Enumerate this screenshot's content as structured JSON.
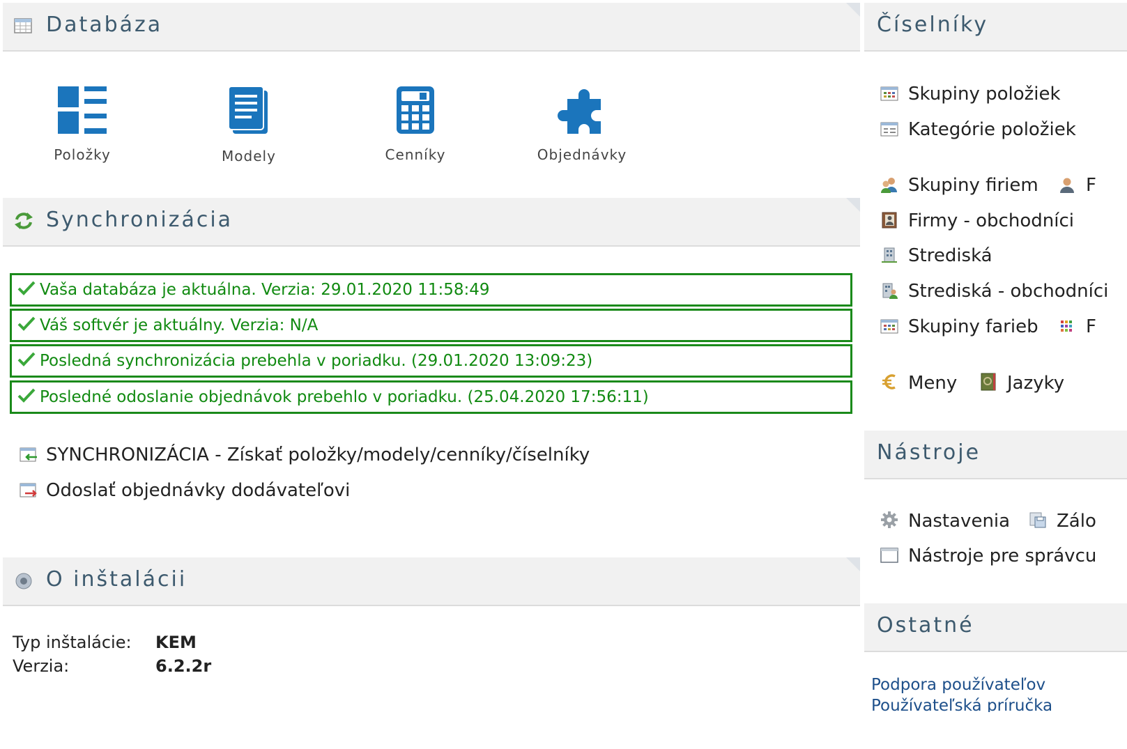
{
  "databaza": {
    "title": "Databáza",
    "tiles": [
      {
        "label": "Položky",
        "icon": "list-grid-icon"
      },
      {
        "label": "Modely",
        "icon": "document-icon"
      },
      {
        "label": "Cenníky",
        "icon": "calculator-icon"
      },
      {
        "label": "Objednávky",
        "icon": "puzzle-icon"
      }
    ]
  },
  "synchronizacia": {
    "title": "Synchronizácia",
    "status": [
      "Vaša databáza je aktuálna. Verzia: 29.01.2020 11:58:49",
      "Váš softvér je aktuálny. Verzia: N/A",
      "Posledná synchronizácia prebehla v poriadku. (29.01.2020 13:09:23)",
      "Posledné odoslanie objednávok prebehlo v poriadku. (25.04.2020 17:56:11)"
    ],
    "actions": [
      "SYNCHRONIZÁCIA - Získať položky/modely/cenníky/číselníky",
      "Odoslať objednávky dodávateľovi"
    ]
  },
  "instalacia": {
    "title": "O inštalácii",
    "rows": [
      {
        "label": "Typ inštalácie:",
        "value": "KEM"
      },
      {
        "label": "Verzia:",
        "value": "6.2.2r"
      }
    ]
  },
  "ciselniky": {
    "title": "Číselníky",
    "items": {
      "skupiny_poloziek": "Skupiny položiek",
      "kategorie_poloziek": "Kategórie položiek",
      "skupiny_firiem": "Skupiny firiem",
      "firmy_partial": "F",
      "firmy_obchodnici": "Firmy - obchodníci",
      "strediska": "Strediská",
      "strediska_obchodnici": "Strediská - obchodníci",
      "skupiny_farieb": "Skupiny farieb",
      "farby_partial": "F",
      "meny": "Meny",
      "jazyky": "Jazyky"
    }
  },
  "nastroje": {
    "title": "Nástroje",
    "items": {
      "nastavenia": "Nastavenia",
      "zaloha_partial": "Zálo",
      "nastroje_spravcu": "Nástroje pre správcu"
    }
  },
  "ostatne": {
    "title": "Ostatné",
    "links": [
      "Podpora používateľov",
      "Používateľská príručka"
    ]
  },
  "colors": {
    "accent_blue": "#1b75bc",
    "status_green": "#118a11",
    "title_color": "#3d5a6e"
  }
}
